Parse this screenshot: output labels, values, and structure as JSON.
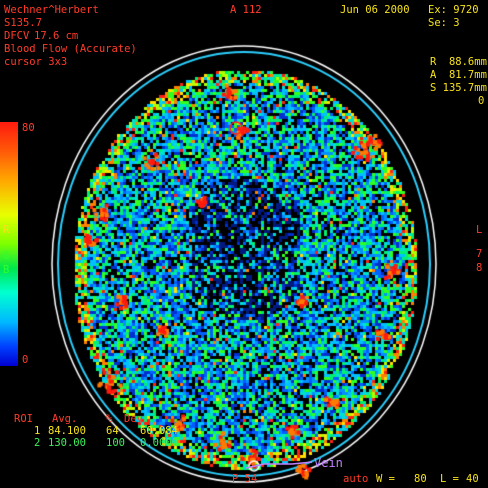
{
  "overlay": {
    "patient_name": "Wechner^Herbert",
    "series_id": "S135.7",
    "dfov_label": "DFCV",
    "dfov_value": "17.6 cm",
    "mode": "Blood Flow (Accurate)",
    "cursor": "cursor 3x3",
    "top_marker": "A 112",
    "date": "Jun 06 2000",
    "exam": "Ex: 9720",
    "series": "Se: 3",
    "pos_r": "R  88.6mm",
    "pos_a": "A  81.7mm",
    "pos_s": "S 135.7mm",
    "pos_extra": "0",
    "side_l": "L",
    "side_7": "7",
    "side_8": "8",
    "bottom_marker": "P 54",
    "bottom_auto": "auto",
    "window_label": "W =",
    "window_value": "80",
    "level_label": "L =",
    "level_value": "40"
  },
  "colorbar": {
    "max": "80",
    "min": "0",
    "letter_r": "R",
    "letter_g": "G",
    "letter_b": "B",
    "max_value": 80,
    "min_value": 0
  },
  "roi_table": {
    "headers": [
      "ROI",
      "Avg.",
      "%",
      "Dev"
    ],
    "rows": [
      {
        "id": "1",
        "avg": "84.100",
        "pct": "64",
        "dev": "60.084"
      },
      {
        "id": "2",
        "avg": "130.00",
        "pct": "100",
        "dev": "0.0000"
      }
    ]
  },
  "annotations": {
    "vein_label": "Vein"
  },
  "colors": {
    "overlay_red": "#ff3b2a",
    "overlay_yellow": "#f6e21c",
    "roi2_green": "#3ef05a",
    "annotation_violet": "#c080ff"
  }
}
